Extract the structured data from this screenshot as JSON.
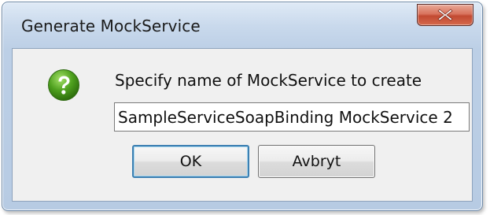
{
  "window": {
    "title": "Generate MockService",
    "close_label": "X"
  },
  "dialog": {
    "icon": "question-icon",
    "prompt": "Specify name of MockService to create",
    "input_value": "SampleServiceSoapBinding MockService 2",
    "ok_label": "OK",
    "cancel_label": "Avbryt"
  },
  "colors": {
    "title_bar": "#c9d9ec",
    "close_button": "#c94d35",
    "content_bg": "#f0f0f0",
    "help_icon": "#4ea01e",
    "ok_border": "#3c7fb1"
  }
}
